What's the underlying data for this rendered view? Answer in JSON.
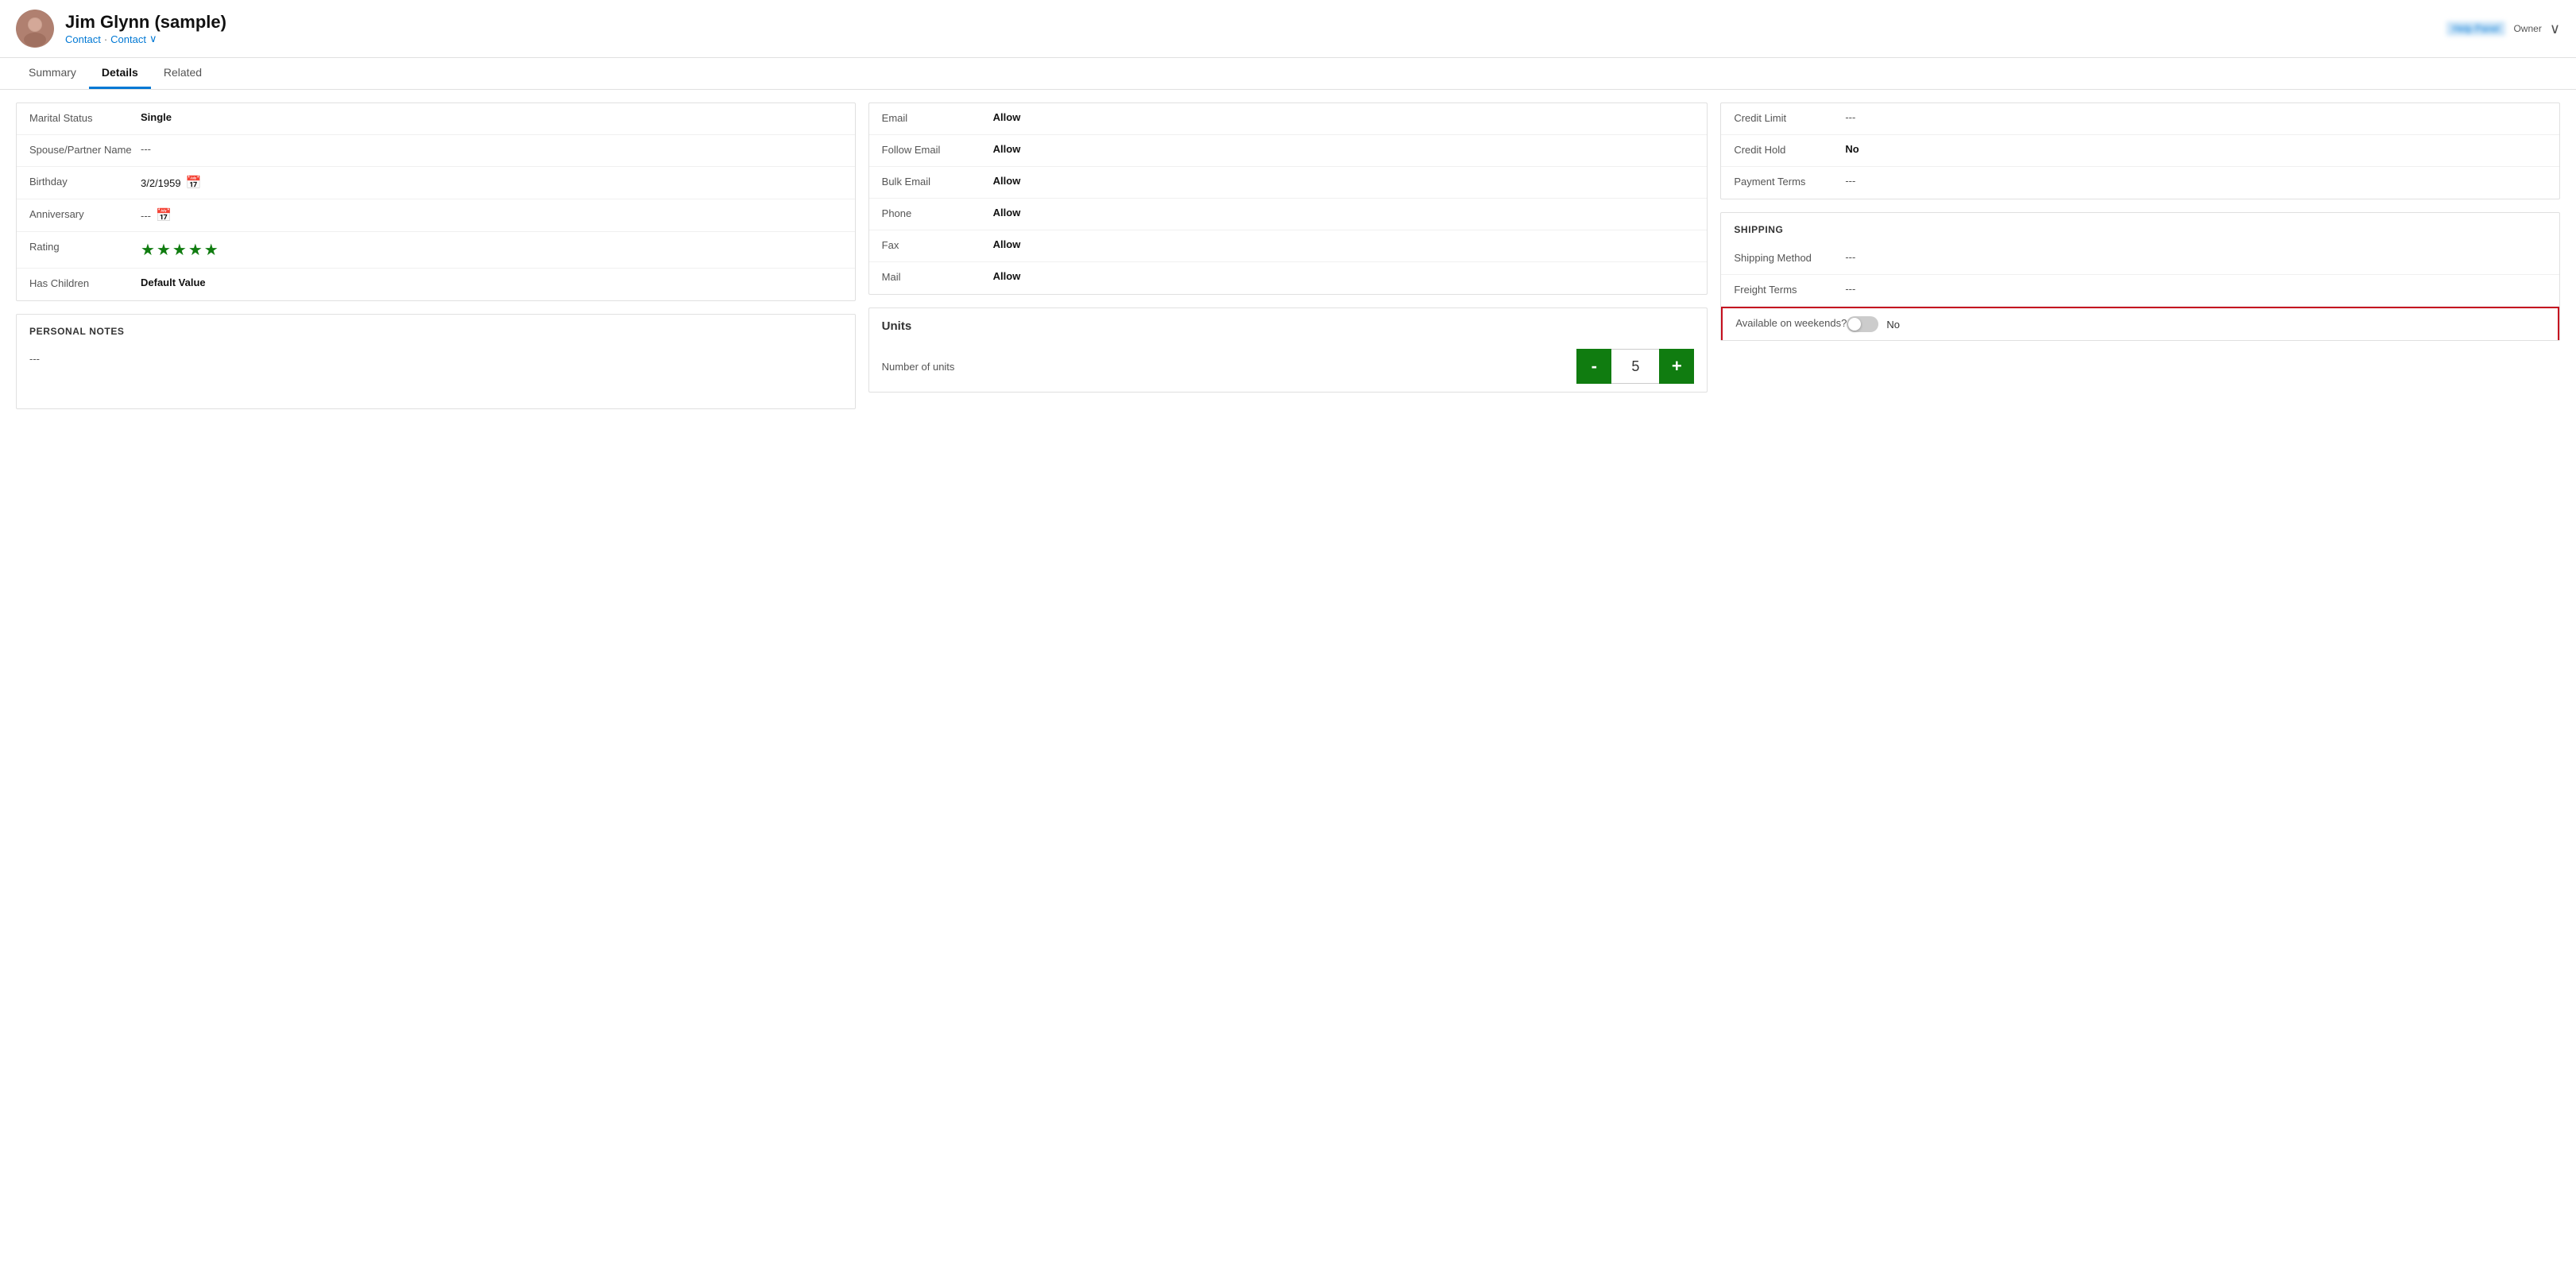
{
  "header": {
    "name": "Jim Glynn (sample)",
    "sub_type1": "Contact",
    "sub_separator": "·",
    "sub_type2": "Contact",
    "sub_chevron": "∨",
    "owner_label": "Owner",
    "chevron": "∨"
  },
  "tabs": [
    {
      "id": "summary",
      "label": "Summary",
      "active": false
    },
    {
      "id": "details",
      "label": "Details",
      "active": true
    },
    {
      "id": "related",
      "label": "Related",
      "active": false
    }
  ],
  "personal_info": {
    "section_title": "",
    "fields": [
      {
        "label": "Marital Status",
        "value": "Single",
        "bold": true
      },
      {
        "label": "Spouse/Partner Name",
        "value": "---",
        "bold": false
      },
      {
        "label": "Birthday",
        "value": "3/2/1959",
        "bold": false,
        "has_icon": true
      },
      {
        "label": "Anniversary",
        "value": "---",
        "bold": false,
        "has_icon": true
      },
      {
        "label": "Rating",
        "value": "stars",
        "bold": false
      },
      {
        "label": "Has Children",
        "value": "Default Value",
        "bold": true
      }
    ],
    "stars_count": 5
  },
  "personal_notes": {
    "title": "PERSONAL NOTES",
    "content": "---"
  },
  "contact_preferences": {
    "fields": [
      {
        "label": "Email",
        "value": "Allow",
        "bold": true
      },
      {
        "label": "Follow Email",
        "value": "Allow",
        "bold": true
      },
      {
        "label": "Bulk Email",
        "value": "Allow",
        "bold": true
      },
      {
        "label": "Phone",
        "value": "Allow",
        "bold": true
      },
      {
        "label": "Fax",
        "value": "Allow",
        "bold": true
      },
      {
        "label": "Mail",
        "value": "Allow",
        "bold": true
      }
    ]
  },
  "units": {
    "title": "Units",
    "field_label": "Number of units",
    "value": "5",
    "minus_label": "-",
    "plus_label": "+"
  },
  "billing": {
    "fields": [
      {
        "label": "Credit Limit",
        "value": "---",
        "bold": false
      },
      {
        "label": "Credit Hold",
        "value": "No",
        "bold": true
      },
      {
        "label": "Payment Terms",
        "value": "---",
        "bold": false
      }
    ]
  },
  "shipping": {
    "title": "SHIPPING",
    "fields": [
      {
        "label": "Shipping Method",
        "value": "---",
        "bold": false
      },
      {
        "label": "Freight Terms",
        "value": "---",
        "bold": false
      }
    ],
    "highlighted_field": {
      "label": "Available on weekends?",
      "value": "No",
      "is_toggle": true,
      "toggle_on": false
    }
  },
  "icons": {
    "calendar": "📅",
    "chevron_down": "⌄",
    "star": "★"
  }
}
